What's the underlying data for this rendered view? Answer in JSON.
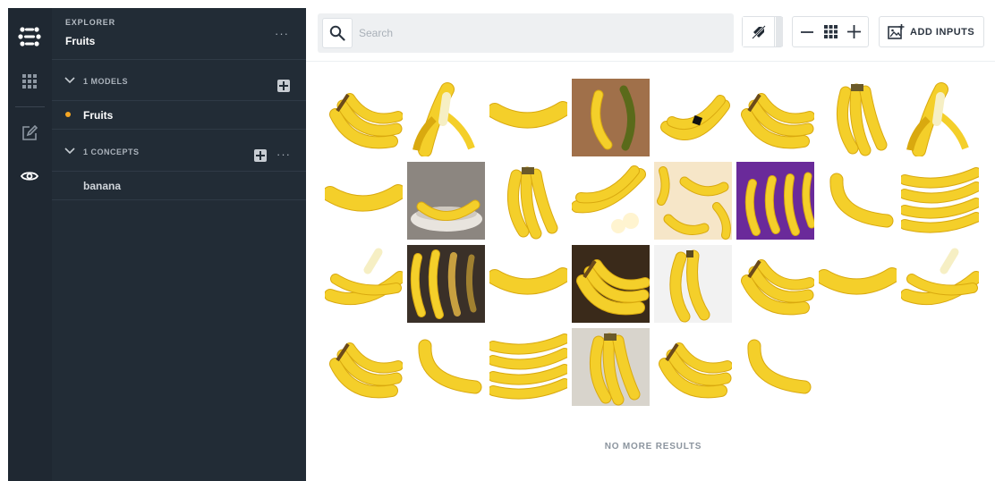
{
  "explorer": {
    "label": "EXPLORER",
    "title": "Fruits",
    "more_label": "···"
  },
  "models": {
    "header": "1 MODELS",
    "items": [
      {
        "label": "Fruits",
        "status_color": "#f5a623"
      }
    ]
  },
  "concepts": {
    "header": "1 CONCEPTS",
    "more_label": "···",
    "items": [
      {
        "label": "banana"
      }
    ]
  },
  "search": {
    "placeholder": "Search",
    "value": ""
  },
  "toolbar": {
    "add_inputs_label": "ADD INPUTS",
    "zoom_out_icon": "minus-icon",
    "grid_icon": "grid-icon",
    "zoom_in_icon": "plus-icon",
    "tag_toggle_icon": "tag-off-icon"
  },
  "gallery": {
    "tiles": [
      {
        "bg": "#ffffff",
        "kind": "bunch"
      },
      {
        "bg": "#ffffff",
        "kind": "peeled"
      },
      {
        "bg": "#ffffff",
        "kind": "single"
      },
      {
        "bg": "#a0704a",
        "kind": "wood-pair"
      },
      {
        "bg": "#ffffff",
        "kind": "sticker"
      },
      {
        "bg": "#ffffff",
        "kind": "bunch"
      },
      {
        "bg": "#ffffff",
        "kind": "bunch-hang"
      },
      {
        "bg": "#ffffff",
        "kind": "peeled"
      },
      {
        "bg": "#ffffff",
        "kind": "single"
      },
      {
        "bg": "#6b6b6b",
        "kind": "bowl"
      },
      {
        "bg": "#ffffff",
        "kind": "bunch-hang"
      },
      {
        "bg": "#ffffff",
        "kind": "sliced"
      },
      {
        "bg": "#f6e6c8",
        "kind": "scattered"
      },
      {
        "bg": "#6a2a9a",
        "kind": "row"
      },
      {
        "bg": "#ffffff",
        "kind": "single-curve"
      },
      {
        "bg": "#ffffff",
        "kind": "stack"
      },
      {
        "bg": "#ffffff",
        "kind": "half-peeled"
      },
      {
        "bg": "#3a3028",
        "kind": "dark-row"
      },
      {
        "bg": "#ffffff",
        "kind": "single"
      },
      {
        "bg": "#3a2a1a",
        "kind": "bunch"
      },
      {
        "bg": "#f2f2f2",
        "kind": "pair"
      },
      {
        "bg": "#ffffff",
        "kind": "bunch"
      },
      {
        "bg": "#ffffff",
        "kind": "single"
      },
      {
        "bg": "#ffffff",
        "kind": "half-peeled"
      },
      {
        "bg": "#ffffff",
        "kind": "bunch"
      },
      {
        "bg": "#ffffff",
        "kind": "single-curve"
      },
      {
        "bg": "#ffffff",
        "kind": "stack"
      },
      {
        "bg": "#d8d4cc",
        "kind": "bunch-hang"
      },
      {
        "bg": "#ffffff",
        "kind": "bunch"
      },
      {
        "bg": "#ffffff",
        "kind": "single-curve"
      }
    ],
    "end_label": "NO MORE RESULTS"
  },
  "colors": {
    "rail": "#1f2832",
    "panel": "#222c36",
    "accent": "#f5a623",
    "banana": "#f4cf2a",
    "banana_shade": "#d9a90f"
  }
}
